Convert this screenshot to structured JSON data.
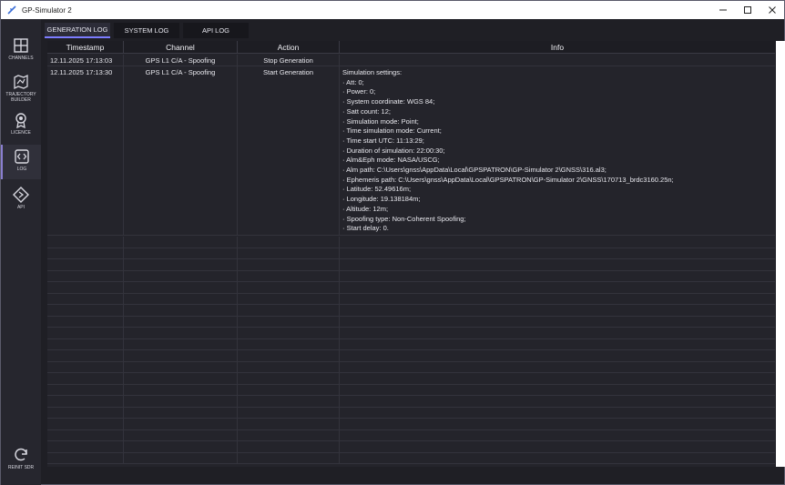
{
  "window": {
    "title": "GP-Simulator 2"
  },
  "sidebar": {
    "items": [
      {
        "label": "CHANNELS",
        "icon": "channels-icon"
      },
      {
        "label": "TRAJECTORY BUILDER",
        "icon": "trajectory-icon"
      },
      {
        "label": "LICENCE",
        "icon": "licence-icon"
      },
      {
        "label": "LOG",
        "icon": "log-icon",
        "active": true
      },
      {
        "label": "API",
        "icon": "api-icon"
      }
    ],
    "bottom": {
      "label": "REINIT SDR",
      "icon": "refresh-icon"
    }
  },
  "tabs": [
    {
      "label": "GENERATION LOG",
      "active": true
    },
    {
      "label": "SYSTEM LOG"
    },
    {
      "label": "API LOG"
    }
  ],
  "table": {
    "headers": [
      "Timestamp",
      "Channel",
      "Action",
      "Info"
    ],
    "rows": [
      {
        "timestamp": "12.11.2025 17:13:03",
        "channel": "GPS L1 C/A - Spoofing",
        "action": "Stop Generation",
        "info": []
      },
      {
        "timestamp": "12.11.2025 17:13:30",
        "channel": "GPS L1 C/A - Spoofing",
        "action": "Start Generation",
        "info": [
          "Simulation settings:",
          "· Att: 0;",
          "· Power: 0;",
          "· System coordinate: WGS 84;",
          "· Satt count: 12;",
          "· Simulation mode: Point;",
          "· Time simulation mode: Current;",
          "· Time start UTC: 11:13:29;",
          "· Duration of simulation:  22:00:30;",
          "· Alm&Eph mode: NASA/USCG;",
          "· Alm path: C:\\Users\\gnss\\AppData\\Local\\GPSPATRON\\GP-Simulator 2\\GNSS\\316.al3;",
          "· Ephemeris path: C:\\Users\\gnss\\AppData\\Local\\GPSPATRON\\GP-Simulator 2\\GNSS\\170713_brdc3160.25n;",
          "· Latitude: 52.49616m;",
          "· Longitude: 19.138184m;",
          "· Altitude: 12m;",
          "· Spoofing type: Non-Coherent Spoofing;",
          "· Start delay: 0."
        ]
      }
    ]
  },
  "colors": {
    "accent": "#7c7cff",
    "background": "#1f1f25",
    "sidebar": "#26262e"
  }
}
